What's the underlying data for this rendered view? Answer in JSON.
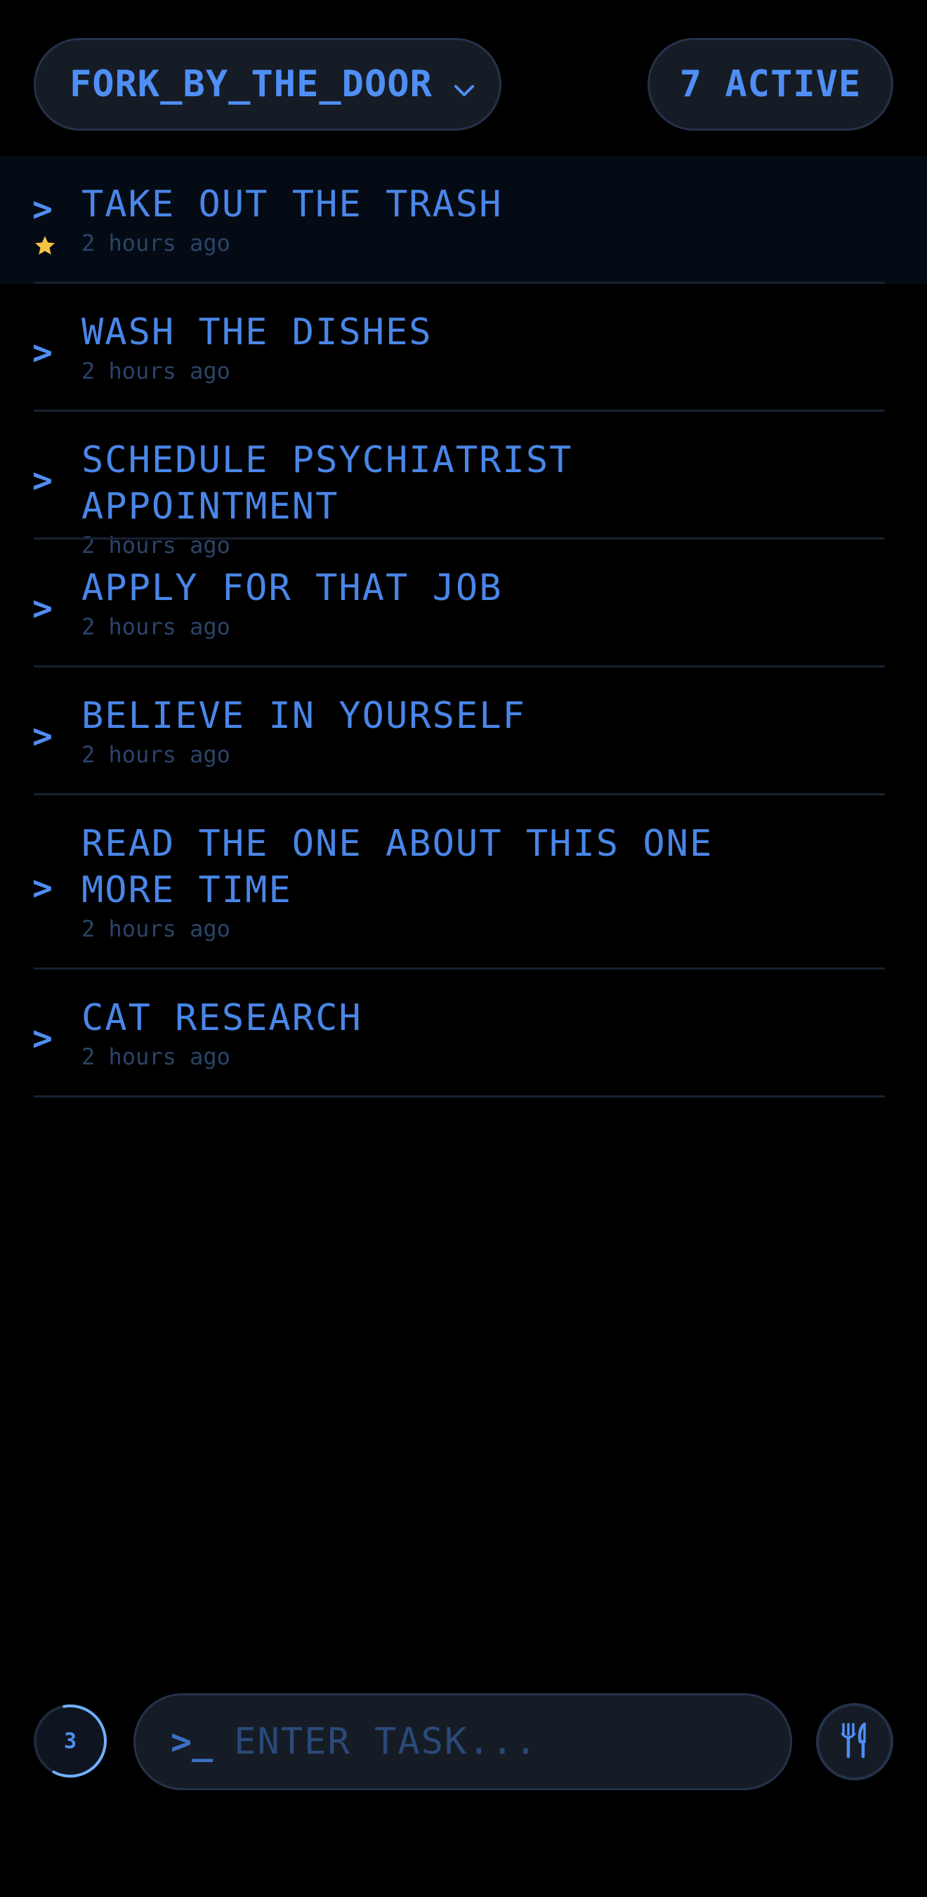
{
  "header": {
    "workspace_label": "FORK_BY_THE_DOOR",
    "active_count_label": "7 ACTIVE"
  },
  "tasks": [
    {
      "title": "TAKE OUT THE TRASH",
      "time": "2 hours ago",
      "starred": true
    },
    {
      "title": "WASH THE DISHES",
      "time": "2 hours ago",
      "starred": false
    },
    {
      "title": "SCHEDULE PSYCHIATRIST APPOINTMENT",
      "time": "2 hours ago",
      "starred": false
    },
    {
      "title": "APPLY FOR THAT JOB",
      "time": "2 hours ago",
      "starred": false
    },
    {
      "title": "BELIEVE IN YOURSELF",
      "time": "2 hours ago",
      "starred": false
    },
    {
      "title": "READ THE ONE ABOUT THIS ONE\nMORE TIME",
      "time": "2 hours ago",
      "starred": false
    },
    {
      "title": "CAT RESEARCH",
      "time": "2 hours ago",
      "starred": false
    }
  ],
  "task_chevron": ">",
  "footer": {
    "counter_value": "3",
    "input_prompt": ">_",
    "input_placeholder": "ENTER TASK...",
    "input_value": ""
  },
  "icons": {
    "workspace_chevron": "chevron-down-icon",
    "star": "star-icon",
    "fork_button": "fork-knife-icon"
  },
  "colors": {
    "background": "#000000",
    "accent": "#4f8ff5",
    "pill_background": "#161c26",
    "pill_border": "#24324a",
    "muted_text": "#2a4468",
    "star": "#f5c542",
    "highlight_row": "#050b14"
  }
}
